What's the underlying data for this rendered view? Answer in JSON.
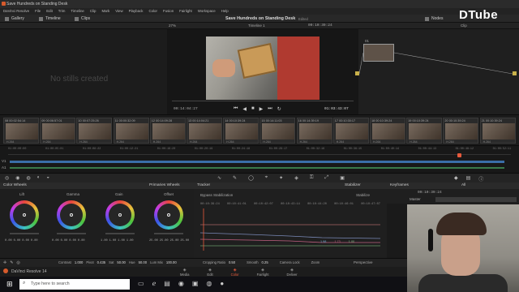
{
  "window": {
    "title": "Save Hundreds on Standing Desk"
  },
  "menu": [
    "DaVinci Resolve",
    "File",
    "Edit",
    "Trim",
    "Timeline",
    "Clip",
    "Mark",
    "View",
    "Playback",
    "Color",
    "Fusion",
    "Fairlight",
    "Workspace",
    "Help"
  ],
  "toolbar": {
    "gallery": "Gallery",
    "timeline": "Timeline",
    "clips": "Clips",
    "project_title": "Save Hundreds on Standing Desk",
    "edited": "Edited",
    "nodes": "Nodes"
  },
  "subbar": {
    "zoom": "27%",
    "timeline_name": "Timeline 1",
    "timecode": "00:10:39:24",
    "clip_label": "Clip"
  },
  "gallery": {
    "empty_message": "No stills created"
  },
  "viewer": {
    "timecode_left": "00:14:04:27",
    "timecode_right": "01:03:43:07"
  },
  "node": {
    "label": "01"
  },
  "clips": [
    {
      "num": "08",
      "tc": "00:02:54:14",
      "codec": "H.264"
    },
    {
      "num": "09",
      "tc": "00:06:57:01",
      "codec": "H.264"
    },
    {
      "num": "10",
      "tc": "00:07:25:26",
      "codec": "H.264"
    },
    {
      "num": "11",
      "tc": "00:00:32:09",
      "codec": "H.264"
    },
    {
      "num": "12",
      "tc": "00:14:09:28",
      "codec": "H.264"
    },
    {
      "num": "13",
      "tc": "00:14:04:21",
      "codec": "H.264"
    },
    {
      "num": "14",
      "tc": "00:10:39:24",
      "codec": "H.264"
    },
    {
      "num": "15",
      "tc": "00:14:11:03",
      "codec": "H.264"
    },
    {
      "num": "16",
      "tc": "00:14:39:19",
      "codec": "H.264"
    },
    {
      "num": "17",
      "tc": "00:10:30:17",
      "codec": "H.264"
    },
    {
      "num": "18",
      "tc": "00:10:39:24",
      "codec": "H.264"
    },
    {
      "num": "19",
      "tc": "00:10:39:24",
      "codec": "H.264"
    },
    {
      "num": "20",
      "tc": "00:10:39:24",
      "codec": "H.264"
    },
    {
      "num": "21",
      "tc": "00:10:39:24",
      "codec": "H.264"
    }
  ],
  "timeline_ruler": [
    "01:00:00:00",
    "01:00:05:01",
    "01:00:08:22",
    "01:00:12:21",
    "01:00:16:20",
    "01:00:20:19",
    "01:00:24:18",
    "01:00:28:17",
    "01:00:32:16",
    "01:00:36:15",
    "01:00:40:14",
    "01:00:44:13",
    "01:00:48:12",
    "01:00:52:11"
  ],
  "panels": {
    "color_wheels": "Color Wheels",
    "primaries": "Primaries Wheels",
    "tracker": "Tracker",
    "stabilizer": "Stabilizer",
    "keyframes": "Keyframes",
    "keyframes_filter": "All",
    "keyframes_tc": "00:10:39:24",
    "master": "Master"
  },
  "wheels": [
    {
      "name": "Lift",
      "values": [
        "0.00",
        "0.00",
        "0.00",
        "0.00"
      ]
    },
    {
      "name": "Gamma",
      "values": [
        "0.00",
        "0.00",
        "0.00",
        "0.00"
      ]
    },
    {
      "name": "Gain",
      "values": [
        "1.00",
        "1.00",
        "1.00",
        "1.00"
      ]
    },
    {
      "name": "Offset",
      "values": [
        "25.00",
        "25.00",
        "25.00",
        "25.00"
      ]
    }
  ],
  "adjust": {
    "contrast_label": "Contrast",
    "contrast": "1.000",
    "pivot_label": "Pivot",
    "pivot": "0.435",
    "sat_label": "Sat",
    "sat": "50.00",
    "hue_label": "Hue",
    "hue": "50.00",
    "lummix_label": "Lum Mix",
    "lummix": "100.00"
  },
  "tracker": {
    "bypass": "Bypass Stabilization",
    "stabilize": "Stabilize",
    "cropping_label": "Cropping Ratio",
    "cropping": "0.50",
    "smooth_label": "Smooth",
    "smooth": "0.25",
    "camlock": "Camera Lock",
    "zoom": "Zoom",
    "perspective": "Perspective",
    "ruler": [
      "00:10:39:24",
      "00:10:41:01",
      "00:10:42:07",
      "00:10:43:14",
      "00:10:44:20",
      "00:10:46:01",
      "00:10:47:07"
    ],
    "readouts": [
      "1.98",
      "1.73",
      "1.00"
    ]
  },
  "pages": [
    "Media",
    "Edit",
    "Color",
    "Fairlight",
    "Deliver"
  ],
  "active_page": "Color",
  "app_name": "DaVinci Resolve 14",
  "taskbar": {
    "search": "Type here to search"
  },
  "watermark": "DTube",
  "colors": {
    "accent": "#e3a04a",
    "panel": "#1e1e1e",
    "active_page": "#e85a3c"
  }
}
